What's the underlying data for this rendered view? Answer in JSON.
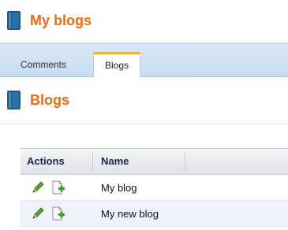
{
  "header": {
    "title": "My blogs",
    "icon": "book-icon"
  },
  "tabs": [
    {
      "label": "Comments",
      "selected": false
    },
    {
      "label": "Blogs",
      "selected": true
    }
  ],
  "section": {
    "title": "Blogs",
    "icon": "book-icon"
  },
  "grid": {
    "columns": [
      "Actions",
      "Name"
    ],
    "rows": [
      {
        "name": "My blog",
        "actions": [
          "edit-icon",
          "new-post-icon"
        ]
      },
      {
        "name": "My new blog",
        "actions": [
          "edit-icon",
          "new-post-icon"
        ]
      }
    ]
  },
  "colors": {
    "accent": "#f06a0f",
    "tab_highlight": "#f3b23a",
    "tab_strip": "#c8dcf1"
  }
}
